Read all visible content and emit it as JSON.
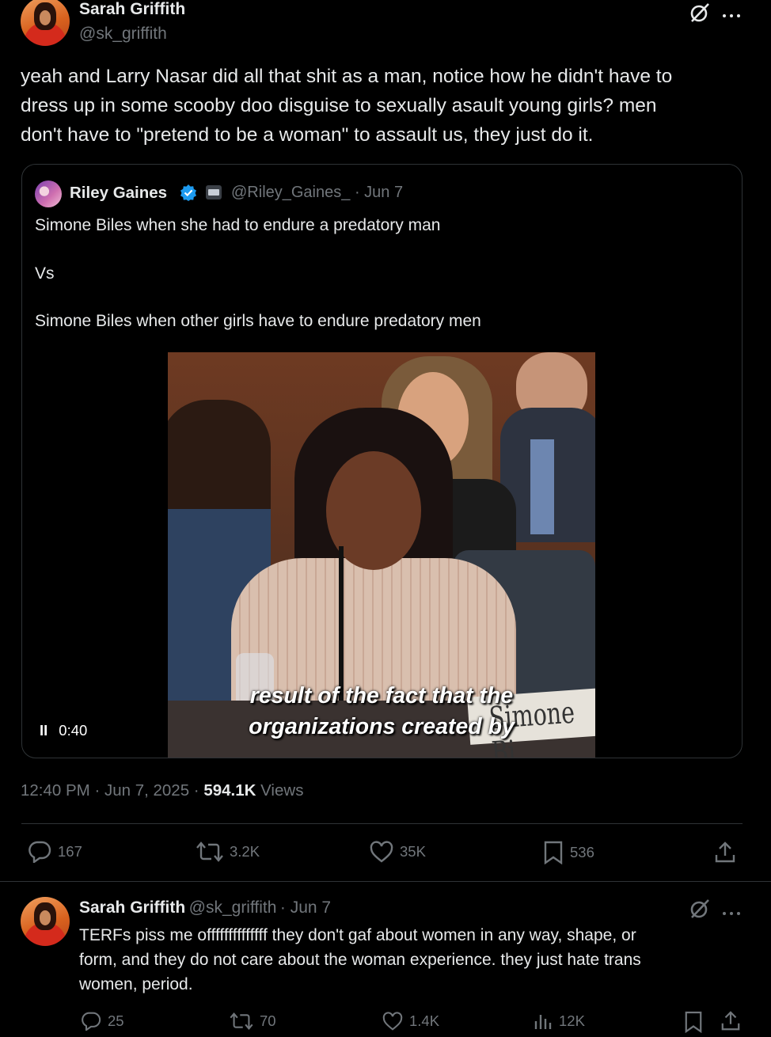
{
  "main_post": {
    "author_name": "Sarah Griffith",
    "author_handle": "@sk_griffith",
    "text_lines": [
      "yeah and Larry Nasar did all that shit as a man, notice how he didn't have to",
      "dress up in some scooby doo disguise to sexually asault young girls? men",
      "don't have to \"pretend to be a woman\" to assault us, they just do it."
    ],
    "quote": {
      "author_name": "Riley Gaines",
      "author_handle": "@Riley_Gaines_",
      "date": "· Jun 7",
      "line1": "Simone Biles when she had to endure a predatory man",
      "line2": "Vs",
      "line3": "Simone Biles when other girls have to endure predatory men",
      "video": {
        "play_state": "II",
        "time": "0:40",
        "caption_line1": "result of the fact that the",
        "caption_line2": "organizations created by",
        "nameplate": "Simone Bi"
      }
    },
    "meta": {
      "time": "12:40 PM · Jun 7, 2025 · ",
      "views_count": "594.1K",
      "views_label": " Views"
    },
    "actions": {
      "replies": "167",
      "reposts": "3.2K",
      "likes": "35K",
      "bookmarks": "536"
    }
  },
  "reply_post": {
    "author_name": "Sarah Griffith",
    "author_handle": "@sk_griffith",
    "date": "· Jun 7",
    "text_lines": [
      "TERFs piss me offffffffffffff they don't gaf about women in any way, shape, or",
      "form, and they do not care about the woman experience. they just hate trans",
      "women, period."
    ],
    "actions": {
      "replies": "25",
      "reposts": "70",
      "likes": "1.4K",
      "views": "12K"
    }
  },
  "icons": [
    "grok-icon",
    "more-icon",
    "verified-badge-icon",
    "affiliate-badge-icon",
    "reply-icon",
    "repost-icon",
    "like-icon",
    "bookmark-icon",
    "share-icon",
    "views-icon"
  ],
  "colors": {
    "background": "#000000",
    "text": "#e7e9ea",
    "muted": "#71767b",
    "border": "#2f3336",
    "verified": "#1d9bf0"
  }
}
